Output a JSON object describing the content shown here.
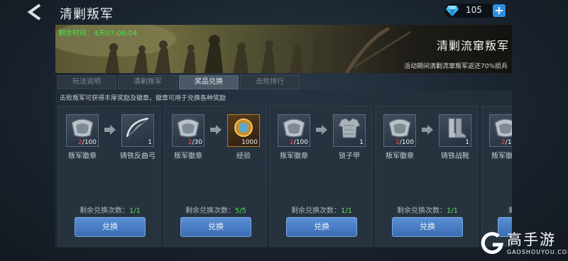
{
  "header": {
    "title": "清剿叛军",
    "currency": {
      "icon": "diamond-gem-icon",
      "value": "105",
      "add_label": "+"
    }
  },
  "banner": {
    "timer": "剩余时间：4天07:06:04",
    "title": "清剿流窜叛军",
    "description": "活动期间清剿流窜叛军返还70%损兵"
  },
  "tabs": [
    {
      "label": "玩法说明",
      "active": false
    },
    {
      "label": "清剿叛军",
      "active": false
    },
    {
      "label": "奖品兑换",
      "active": true
    },
    {
      "label": "击败排行",
      "active": false
    }
  ],
  "hint": "击败叛军可获得丰厚奖励及徽章，徽章可用于兑换各种奖励",
  "remain_label": "剩余兑换次数：",
  "exchange_label": "兑换",
  "cards": [
    {
      "from_name": "叛军徽章",
      "from_have": "2",
      "from_need": "/100",
      "to_name": "铸铁反曲弓",
      "to_count": "1",
      "to_icon": "bow-icon",
      "remain": "1/1"
    },
    {
      "from_name": "叛军徽章",
      "from_have": "2",
      "from_need": "/30",
      "to_name": "经验",
      "to_count": "1000",
      "to_icon": "experience-medal-icon",
      "remain": "5/5"
    },
    {
      "from_name": "叛军徽章",
      "from_have": "2",
      "from_need": "/100",
      "to_name": "锁子甲",
      "to_count": "1",
      "to_icon": "chainmail-armor-icon",
      "remain": "1/1"
    },
    {
      "from_name": "叛军徽章",
      "from_have": "2",
      "from_need": "/100",
      "to_name": "铸铁战靴",
      "to_count": "1",
      "to_icon": "iron-boots-icon",
      "remain": "1/1"
    },
    {
      "from_name": "叛军徽章",
      "from_have": "2",
      "from_need": "/100",
      "to_name": "",
      "to_count": "",
      "to_icon": "",
      "remain": ""
    }
  ],
  "watermark": {
    "text": "高手游",
    "sub": "GAOSHOUYOU.COM"
  },
  "colors": {
    "accent_blue": "#3a6cb3",
    "count_green": "#57e057",
    "count_red": "#ff4a4a",
    "timer_green": "#4fe04f"
  }
}
